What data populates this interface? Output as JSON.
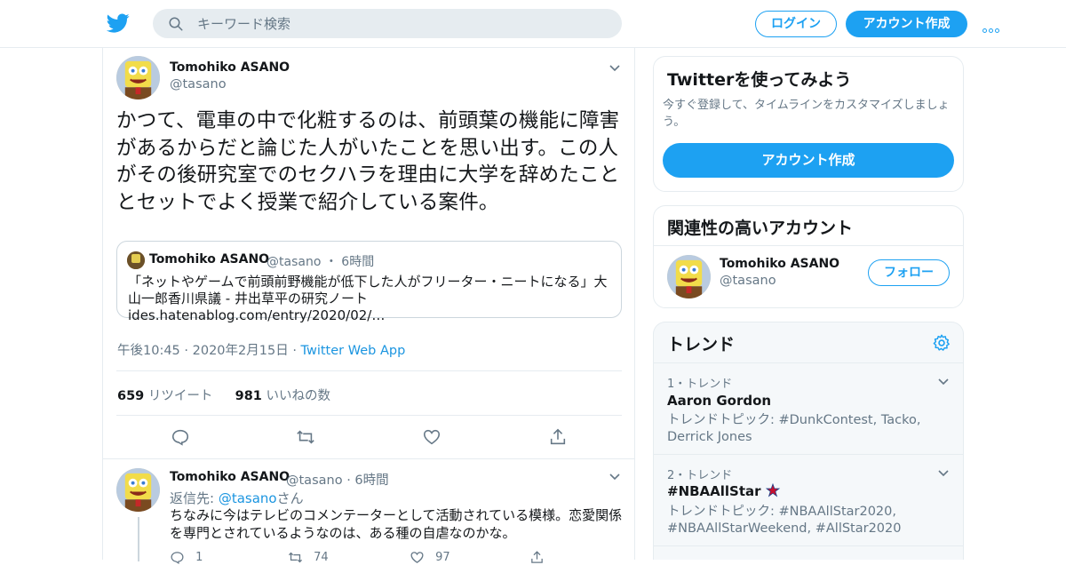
{
  "header": {
    "search_placeholder": "キーワード検索",
    "login_label": "ログイン",
    "signup_label": "アカウント作成"
  },
  "tweet": {
    "author_name": "Tomohiko ASANO",
    "author_handle": "@tasano",
    "text": "かつて、電車の中で化粧するのは、前頭葉の機能に障害があるからだと論じた人がいたことを思い出す。この人がその後研究室でのセクハラを理由に大学を辞めたこととセットでよく授業で紹介している案件。",
    "quote": {
      "name": "Tomohiko ASANO",
      "handle": "@tasano",
      "time": "6時間",
      "text": "「ネットやゲームで前頭前野機能が低下した人がフリーター・ニートになる」大山一郎香川県議 - 井出草平の研究ノート ides.hatenablog.com/entry/2020/02/…"
    },
    "timestamp": "午後10:45 · 2020年2月15日",
    "source": "Twitter Web App",
    "retweet_count": "659",
    "retweet_label": "リツイート",
    "like_count": "981",
    "like_label": "いいねの数"
  },
  "reply": {
    "author_name": "Tomohiko ASANO",
    "author_handle": "@tasano",
    "time": "6時間",
    "reply_to_prefix": "返信先: ",
    "reply_to_handle": "@tasano",
    "reply_to_suffix": "さん",
    "text": "ちなみに今はテレビのコメンテーターとして活動されている模様。恋愛関係を専門とされているようなのは、ある種の自虐なのかな。",
    "reply_count": "1",
    "retweet_count": "74",
    "like_count": "97"
  },
  "sidebar": {
    "signup_card": {
      "title": "Twitterを使ってみよう",
      "description": "今すぐ登録して、タイムラインをカスタマイズしましょう。",
      "button": "アカウント作成"
    },
    "related_card": {
      "title": "関連性の高いアカウント",
      "name": "Tomohiko ASANO",
      "handle": "@tasano",
      "follow_label": "フォロー"
    },
    "trends": {
      "title": "トレンド",
      "items": [
        {
          "rank": "1・トレンド",
          "name": "Aaron Gordon",
          "desc": "トレンドトピック: #DunkContest, Tacko, Derrick Jones"
        },
        {
          "rank": "2・トレンド",
          "name": "#NBAAllStar",
          "desc": "トレンドトピック: #NBAAllStar2020, #NBAAllStarWeekend, #AllStar2020"
        }
      ]
    }
  },
  "colors": {
    "accent": "#1da1f2",
    "link": "#1b95e0",
    "secondary_text": "#657786",
    "border": "#e6ecf0"
  }
}
